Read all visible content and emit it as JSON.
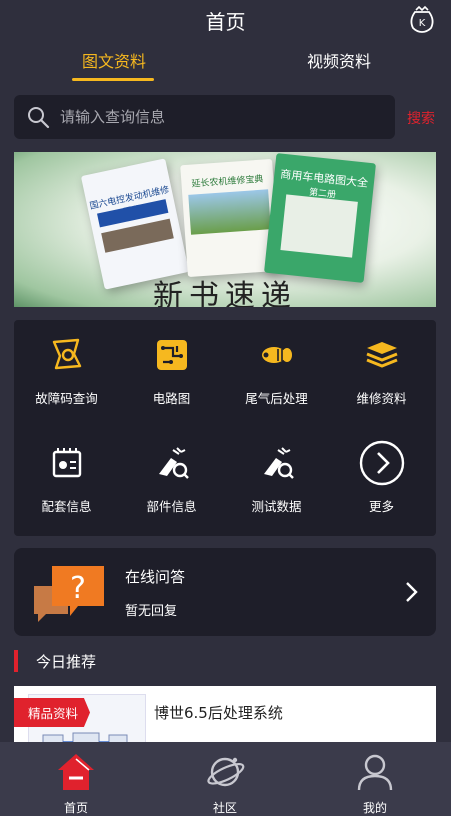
{
  "header": {
    "title": "首页",
    "brand_icon": "k-bag-icon"
  },
  "tabs": [
    {
      "label": "图文资料",
      "active": true
    },
    {
      "label": "视频资料",
      "active": false
    }
  ],
  "search": {
    "placeholder": "请输入查询信息",
    "button_label": "搜索"
  },
  "banner": {
    "caption": "新书速递",
    "books": [
      {
        "title": "国六电控发动机维修图册"
      },
      {
        "title": "延长农机维修宝典"
      },
      {
        "title": "商用车电路图大全",
        "subtitle": "第二册"
      }
    ]
  },
  "grid": [
    {
      "label": "故障码查询",
      "icon": "fault-code-icon"
    },
    {
      "label": "电路图",
      "icon": "circuit-icon"
    },
    {
      "label": "尾气后处理",
      "icon": "exhaust-icon"
    },
    {
      "label": "维修资料",
      "icon": "manual-stack-icon"
    },
    {
      "label": "配套信息",
      "icon": "parts-box-icon"
    },
    {
      "label": "部件信息",
      "icon": "component-search-icon"
    },
    {
      "label": "测试数据",
      "icon": "test-data-icon"
    },
    {
      "label": "更多",
      "icon": "chevron-right-circle-icon"
    }
  ],
  "qa": {
    "title": "在线问答",
    "subtitle": "暂无回复",
    "icon": "question-bubble-icon"
  },
  "section": {
    "title": "今日推荐"
  },
  "recommend": {
    "badge": "精品资料",
    "title": "博世6.5后处理系统"
  },
  "tabbar": [
    {
      "label": "首页",
      "icon": "home-icon",
      "active": true
    },
    {
      "label": "社区",
      "icon": "planet-icon",
      "active": false
    },
    {
      "label": "我的",
      "icon": "user-icon",
      "active": false
    }
  ],
  "colors": {
    "accent": "#f6b81f",
    "red": "#e0222d",
    "bg": "#2f2f3d",
    "panel": "#1e1e29"
  }
}
